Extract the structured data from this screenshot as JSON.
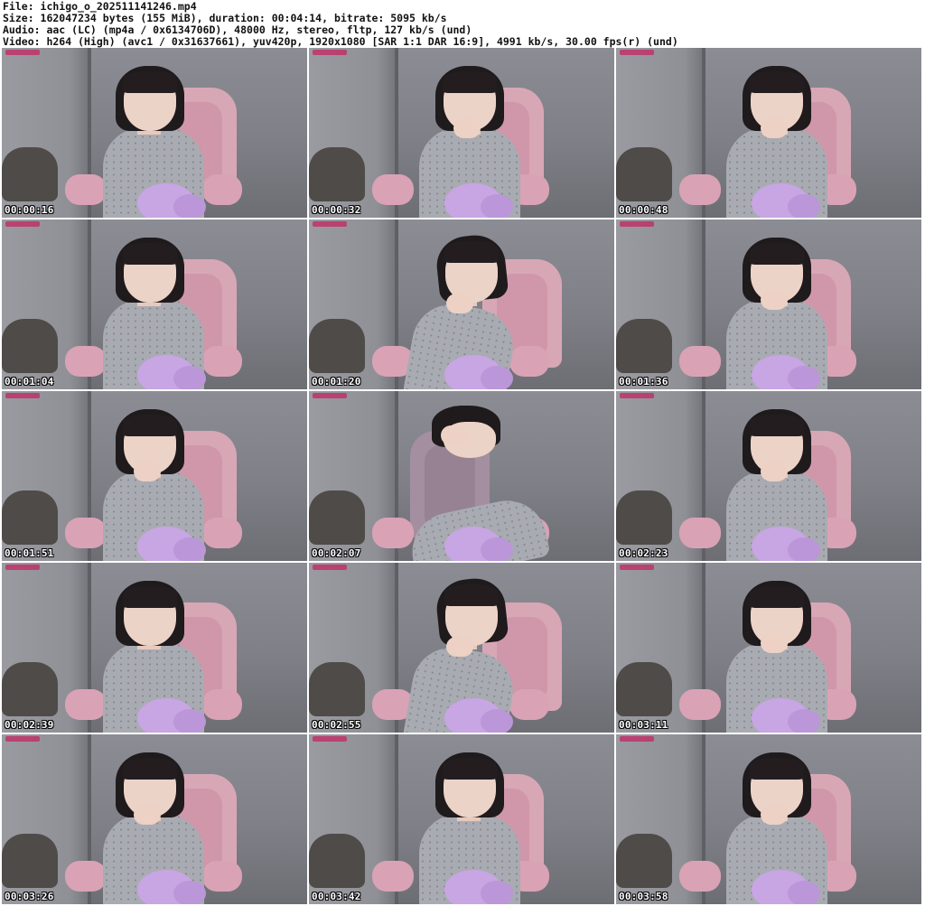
{
  "header": {
    "file_line": "File: ichigo_o_202511141246.mp4",
    "size_line": "Size: 162047234 bytes (155 MiB), duration: 00:04:14, bitrate: 5095 kb/s",
    "audio_line": "Audio: aac (LC) (mp4a / 0x6134706D), 48000 Hz, stereo, fltp, 127 kb/s (und)",
    "video_line": "Video: h264 (High) (avc1 / 0x31637661), yuv420p, 1920x1080 [SAR 1:1 DAR 16:9], 4991 kb/s, 30.00 fps(r) (und)"
  },
  "thumbnails": [
    {
      "timestamp": "00:00:16"
    },
    {
      "timestamp": "00:00:32"
    },
    {
      "timestamp": "00:00:48"
    },
    {
      "timestamp": "00:01:04"
    },
    {
      "timestamp": "00:01:20"
    },
    {
      "timestamp": "00:01:36"
    },
    {
      "timestamp": "00:01:51"
    },
    {
      "timestamp": "00:02:07"
    },
    {
      "timestamp": "00:02:23"
    },
    {
      "timestamp": "00:02:39"
    },
    {
      "timestamp": "00:02:55"
    },
    {
      "timestamp": "00:03:11"
    },
    {
      "timestamp": "00:03:26"
    },
    {
      "timestamp": "00:03:42"
    },
    {
      "timestamp": "00:03:58"
    }
  ],
  "colors": {
    "timestamp_text": "#ffffff",
    "watermark": "#c0336b",
    "chair_pink": "#d8a7b6",
    "plush_purple": "#c8a5e3",
    "sweater_gray": "#a9abb2"
  }
}
